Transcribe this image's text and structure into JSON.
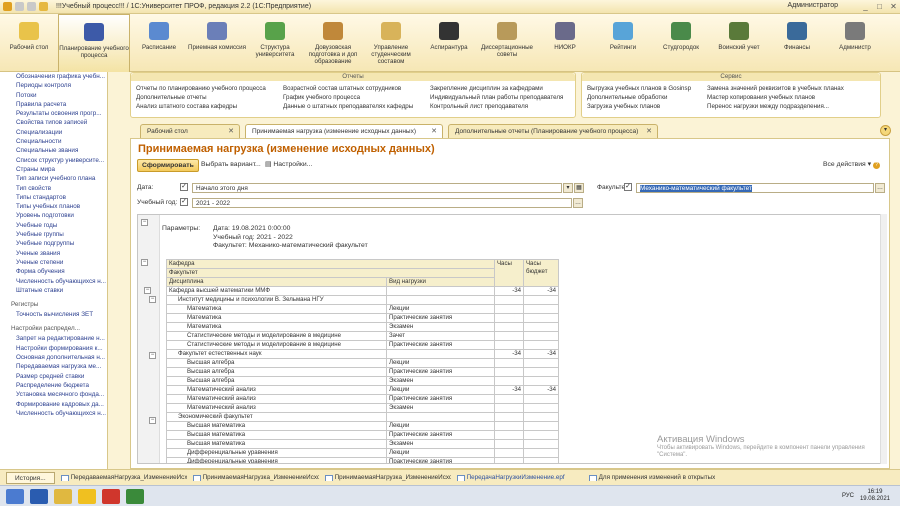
{
  "window": {
    "title": "!!!Учебный процесс!!! / 1С:Университет ПРОФ, редакция 2.2  (1С:Предприятие)",
    "user": "Администратор"
  },
  "sections": [
    {
      "label": "Рабочий стол",
      "icon": "desktop-icon",
      "color": "#e9c34a"
    },
    {
      "label": "Планирование учебного процесса",
      "icon": "book-icon",
      "color": "#3d5aa8"
    },
    {
      "label": "Расписание",
      "icon": "calendar-icon",
      "color": "#5b8ad0"
    },
    {
      "label": "Приемная комиссия",
      "icon": "id-card-icon",
      "color": "#6b7fb8"
    },
    {
      "label": "Структура университета",
      "icon": "structure-icon",
      "color": "#58a24a"
    },
    {
      "label": "Довузовская подготовка и доп образование",
      "icon": "books-icon",
      "color": "#c0883a"
    },
    {
      "label": "Управление студенческим составом",
      "icon": "students-icon",
      "color": "#d8b35a"
    },
    {
      "label": "Аспирантура",
      "icon": "graduation-cap-icon",
      "color": "#333333"
    },
    {
      "label": "Диссертационные советы",
      "icon": "diploma-icon",
      "color": "#b89a5a"
    },
    {
      "label": "НИОКР",
      "icon": "microscope-icon",
      "color": "#6a6a8a"
    },
    {
      "label": "Рейтинги",
      "icon": "rating-icon",
      "color": "#58a4d8"
    },
    {
      "label": "Студгородок",
      "icon": "people-icon",
      "color": "#4a8a4a"
    },
    {
      "label": "Воинский учет",
      "icon": "soldier-icon",
      "color": "#5a7a3a"
    },
    {
      "label": "Финансы",
      "icon": "finance-icon",
      "color": "#3a6a9a"
    },
    {
      "label": "Администр",
      "icon": "admin-icon",
      "color": "#7a7a7a"
    }
  ],
  "leftnav": {
    "items": [
      "Обозначения графика учебн...",
      "Периоды контроля",
      "Потоки",
      "Правила расчета",
      "Результаты освоения прогр...",
      "Свойства типов записей",
      "Специализации",
      "Специальности",
      "Специальные звания",
      "Список структур университе...",
      "Страны мира",
      "Тип записи учебного плана",
      "Тип свойств",
      "Типы стандартов",
      "Типы учебных планов",
      "Уровень подготовки",
      "Учебные годы",
      "Учебные группы",
      "Учебные подгруппы",
      "Ученые звания",
      "Ученые степени",
      "Форма обучения",
      "Численность обучающихся н...",
      "Штатные ставки"
    ],
    "group_registers": "Регистры",
    "registers": [
      "Точность вычисления ЗЕТ"
    ],
    "group_settings": "Настройки распредел...",
    "settings": [
      "Запрет на редактирование н...",
      "Настройки формирования к...",
      "Основная дополнительная н...",
      "Передаваемая нагрузка ме...",
      "Размер средней ставки",
      "Распределение бюджета",
      "Установка месячного фонда...",
      "Формирование кадровых да...",
      "Численность обучающихся н..."
    ]
  },
  "commands": {
    "col1": [
      "Отчеты по планированию учебного процесса",
      "Дополнительные отчеты",
      "Анализ штатного состава кафедры"
    ],
    "reports_title": "Отчеты",
    "col2": [
      "Возрастной состав штатных сотрудников",
      "График учебного процесса",
      "Данные о штатных преподавателях кафедры"
    ],
    "col3": [
      "Закрепление дисциплин за кафедрами",
      "Индивидуальный план работы преподавателя",
      "Контрольный лист преподавателя"
    ],
    "col4": [
      "Выгрузка учебных планов в Gosinsp",
      "Дополнительные обработки",
      "Загрузка учебных планов"
    ],
    "service_title": "Сервис",
    "col5": [
      "Замена значений реквизитов в учебных планах",
      "Мастер копирования учебных планов",
      "Перенос нагрузки между подразделения..."
    ]
  },
  "tabs": [
    {
      "label": "Рабочий стол"
    },
    {
      "label": "Принимаемая нагрузка (изменение исходных данных)"
    },
    {
      "label": "Дополнительные отчеты (Планирование учебного процесса)"
    }
  ],
  "form": {
    "title": "Принимаемая нагрузка (изменение исходных данных)",
    "generate_btn": "Сформировать",
    "variant_btn": "Выбрать вариант...",
    "settings_btn": "Настройки...",
    "all_actions": "Все действия",
    "date_label": "Дата:",
    "date_value": "Начало этого дня",
    "year_label": "Учебный год:",
    "year_value": "2021 - 2022",
    "faculty_label": "Факультет:",
    "faculty_value": "Механико-математический факультет"
  },
  "report": {
    "params_label": "Параметры:",
    "params": [
      "Дата: 19.08.2021 0:00:00",
      "Учебный год: 2021 - 2022",
      "Факультет: Механико-математический факультет"
    ],
    "headers": {
      "kafedra": "Кафедра",
      "fakultet": "Факультет",
      "disciplina": "Дисциплина",
      "vid": "Вид нагрузки",
      "hours": "Часы",
      "hours_budget": "Часы бюджет"
    },
    "rows": [
      {
        "level": 0,
        "name": "Кафедра высшей математики ММФ",
        "vid": "",
        "h": "-34",
        "hb": "-34"
      },
      {
        "level": 1,
        "name": "Институт медицины и психологии В. Зельмана НГУ",
        "vid": "",
        "h": "",
        "hb": ""
      },
      {
        "level": 2,
        "name": "Математика",
        "vid": "Лекции",
        "h": "",
        "hb": ""
      },
      {
        "level": 2,
        "name": "Математика",
        "vid": "Практические занятия",
        "h": "",
        "hb": ""
      },
      {
        "level": 2,
        "name": "Математика",
        "vid": "Экзамен",
        "h": "",
        "hb": ""
      },
      {
        "level": 2,
        "name": "Статистические методы и моделирование в медицине",
        "vid": "Зачет",
        "h": "",
        "hb": ""
      },
      {
        "level": 2,
        "name": "Статистические методы и моделирование в медицине",
        "vid": "Практические занятия",
        "h": "",
        "hb": ""
      },
      {
        "level": 1,
        "name": "Факультет естественных наук",
        "vid": "",
        "h": "-34",
        "hb": "-34"
      },
      {
        "level": 2,
        "name": "Высшая алгебра",
        "vid": "Лекции",
        "h": "",
        "hb": ""
      },
      {
        "level": 2,
        "name": "Высшая алгебра",
        "vid": "Практические занятия",
        "h": "",
        "hb": ""
      },
      {
        "level": 2,
        "name": "Высшая алгебра",
        "vid": "Экзамен",
        "h": "",
        "hb": ""
      },
      {
        "level": 2,
        "name": "Математический анализ",
        "vid": "Лекции",
        "h": "-34",
        "hb": "-34"
      },
      {
        "level": 2,
        "name": "Математический анализ",
        "vid": "Практические занятия",
        "h": "",
        "hb": ""
      },
      {
        "level": 2,
        "name": "Математический анализ",
        "vid": "Экзамен",
        "h": "",
        "hb": ""
      },
      {
        "level": 1,
        "name": "Экономический факультет",
        "vid": "",
        "h": "",
        "hb": ""
      },
      {
        "level": 2,
        "name": "Высшая математика",
        "vid": "Лекции",
        "h": "",
        "hb": ""
      },
      {
        "level": 2,
        "name": "Высшая математика",
        "vid": "Практические занятия",
        "h": "",
        "hb": ""
      },
      {
        "level": 2,
        "name": "Высшая математика",
        "vid": "Экзамен",
        "h": "",
        "hb": ""
      },
      {
        "level": 2,
        "name": "Дифференциальные уравнения",
        "vid": "Лекции",
        "h": "",
        "hb": ""
      },
      {
        "level": 2,
        "name": "Дифференциальные уравнения",
        "vid": "Практические занятия",
        "h": "",
        "hb": ""
      }
    ]
  },
  "watermark": {
    "line1": "Активация Windows",
    "line2": "Чтобы активировать Windows, перейдите в компонент панели управления \"Система\"."
  },
  "appbar": {
    "history": "История...",
    "tabs": [
      "ПередаваемаяНагрузка_ИзменениеИсходныхД...",
      "ПринимаемаяНагрузка_ИзменениеИсходныхДа...",
      "ПринимаемаяНагрузка_ИзменениеИсходныхДа...",
      "ПередачаНагрузкиИзменение.epf",
      "Для применения изменений в открытых окнах н..."
    ]
  },
  "taskbar": {
    "lang": "РУС",
    "time": "16:19",
    "date": "19.08.2021"
  }
}
